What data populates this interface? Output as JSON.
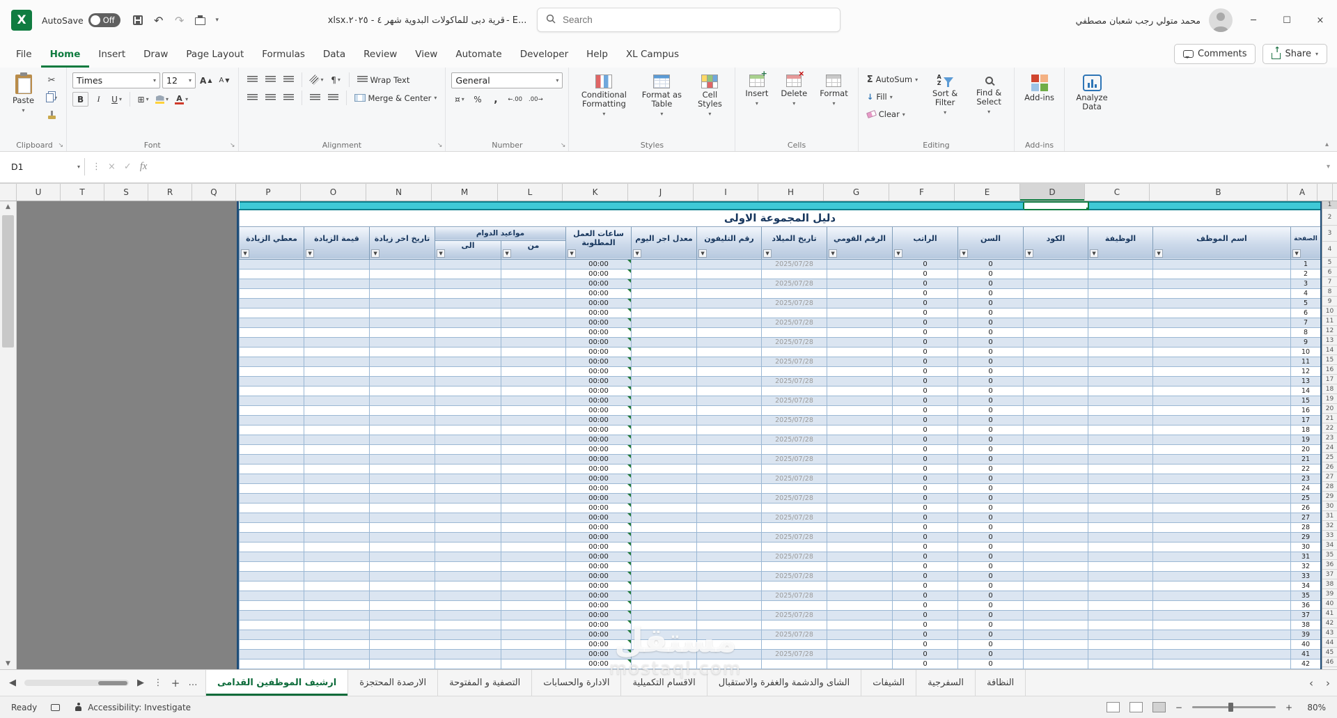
{
  "titlebar": {
    "autosave_label": "AutoSave",
    "autosave_state": "Off",
    "filename_arabic": "قرية دبى للماكولات البدوية شهر ٤ - ٢٠٢٥.xlsx",
    "filename_suffix": " - E...",
    "search_placeholder": "Search",
    "user_name": "محمد متولي رجب شعبان مصطفي"
  },
  "window_controls": {
    "minimize": "─",
    "maximize": "☐",
    "close": "×"
  },
  "ribbon": {
    "tabs": [
      "File",
      "Home",
      "Insert",
      "Draw",
      "Page Layout",
      "Formulas",
      "Data",
      "Review",
      "View",
      "Automate",
      "Developer",
      "Help",
      "XL Campus"
    ],
    "active_tab": "Home",
    "comments_label": "Comments",
    "share_label": "Share",
    "clipboard": {
      "paste": "Paste",
      "cut_glyph": "✂",
      "label": "Clipboard"
    },
    "font": {
      "name": "Times",
      "size": "12",
      "bold": "B",
      "italic": "I",
      "underline": "U",
      "grow": "A",
      "shrink": "A",
      "color_letter": "A",
      "label": "Font"
    },
    "alignment": {
      "wrap": "Wrap Text",
      "merge": "Merge & Center",
      "label": "Alignment"
    },
    "number": {
      "format": "General",
      "accounting": "¤",
      "percent": "%",
      "comma": ",",
      "inc_decimal": "←.00",
      "dec_decimal": ".00→",
      "label": "Number"
    },
    "styles": {
      "conditional": "Conditional Formatting",
      "format_table": "Format as Table",
      "cell_styles": "Cell Styles",
      "label": "Styles"
    },
    "cells": {
      "insert": "Insert",
      "delete": "Delete",
      "format": "Format",
      "label": "Cells"
    },
    "editing": {
      "sum_glyph": "Σ",
      "autosum": "AutoSum",
      "fill": "Fill",
      "clear": "Clear",
      "sort": "Sort & Filter",
      "find": "Find & Select",
      "label": "Editing"
    },
    "addins": {
      "button": "Add-ins",
      "label": "Add-ins"
    },
    "analyze": {
      "button": "Analyze Data"
    }
  },
  "formula_bar": {
    "name_box": "D1",
    "cancel": "×",
    "enter": "✓",
    "fx": "fx"
  },
  "grid": {
    "columns": [
      "U",
      "T",
      "S",
      "R",
      "Q",
      "P",
      "O",
      "N",
      "M",
      "L",
      "K",
      "J",
      "I",
      "H",
      "G",
      "F",
      "E",
      "D",
      "C",
      "B",
      "A"
    ],
    "selected_column": "D",
    "selected_cell": "D1",
    "row_numbers": [
      1,
      2,
      3,
      4,
      5,
      6,
      7,
      8,
      9,
      10,
      11,
      12,
      13,
      14,
      15,
      16,
      17,
      18,
      19,
      20,
      21,
      22,
      23,
      24,
      25,
      26,
      27,
      28,
      29,
      30,
      31,
      32,
      33,
      34,
      35,
      36,
      37,
      38,
      39,
      40,
      41,
      42,
      43,
      44,
      45,
      46
    ]
  },
  "sheet": {
    "title": "دليل المجموعة الاولى",
    "columns": [
      {
        "key": "P",
        "label": "معطي الزيادة"
      },
      {
        "key": "O",
        "label": "قيمة الزيادة"
      },
      {
        "key": "N",
        "label": "تاريخ اخر زيادة"
      },
      {
        "key": "M",
        "label": "الى",
        "group": "مواعيد الدوام"
      },
      {
        "key": "L",
        "label": "من",
        "group": "مواعيد الدوام"
      },
      {
        "key": "K",
        "label": "ساعات العمل المطلوبة"
      },
      {
        "key": "J",
        "label": "معدل اجر اليوم"
      },
      {
        "key": "I",
        "label": "رقم التليفون"
      },
      {
        "key": "H",
        "label": "تاريخ الميلاد"
      },
      {
        "key": "G",
        "label": "الرقم القومي"
      },
      {
        "key": "F",
        "label": "الراتب"
      },
      {
        "key": "E",
        "label": "السن"
      },
      {
        "key": "D",
        "label": "الكود"
      },
      {
        "key": "C",
        "label": "الوظيفة"
      },
      {
        "key": "B",
        "label": "اسم الموظف"
      },
      {
        "key": "A",
        "label": "الصفحة"
      }
    ],
    "rows": [
      {
        "serial": "1",
        "hours": "00:00",
        "birth": "2025/07/28",
        "salary": "0",
        "age": "0"
      },
      {
        "serial": "2",
        "hours": "00:00",
        "birth": "",
        "salary": "0",
        "age": "0"
      },
      {
        "serial": "3",
        "hours": "00:00",
        "birth": "2025/07/28",
        "salary": "0",
        "age": "0"
      },
      {
        "serial": "4",
        "hours": "00:00",
        "birth": "",
        "salary": "0",
        "age": "0"
      },
      {
        "serial": "5",
        "hours": "00:00",
        "birth": "2025/07/28",
        "salary": "0",
        "age": "0"
      },
      {
        "serial": "6",
        "hours": "00:00",
        "birth": "",
        "salary": "0",
        "age": "0"
      },
      {
        "serial": "7",
        "hours": "00:00",
        "birth": "2025/07/28",
        "salary": "0",
        "age": "0"
      },
      {
        "serial": "8",
        "hours": "00:00",
        "birth": "",
        "salary": "0",
        "age": "0"
      },
      {
        "serial": "9",
        "hours": "00:00",
        "birth": "2025/07/28",
        "salary": "0",
        "age": "0"
      },
      {
        "serial": "10",
        "hours": "00:00",
        "birth": "",
        "salary": "0",
        "age": "0"
      },
      {
        "serial": "11",
        "hours": "00:00",
        "birth": "2025/07/28",
        "salary": "0",
        "age": "0"
      },
      {
        "serial": "12",
        "hours": "00:00",
        "birth": "",
        "salary": "0",
        "age": "0"
      },
      {
        "serial": "13",
        "hours": "00:00",
        "birth": "2025/07/28",
        "salary": "0",
        "age": "0"
      },
      {
        "serial": "14",
        "hours": "00:00",
        "birth": "",
        "salary": "0",
        "age": "0"
      },
      {
        "serial": "15",
        "hours": "00:00",
        "birth": "2025/07/28",
        "salary": "0",
        "age": "0"
      },
      {
        "serial": "16",
        "hours": "00:00",
        "birth": "",
        "salary": "0",
        "age": "0"
      },
      {
        "serial": "17",
        "hours": "00:00",
        "birth": "2025/07/28",
        "salary": "0",
        "age": "0"
      },
      {
        "serial": "18",
        "hours": "00:00",
        "birth": "",
        "salary": "0",
        "age": "0"
      },
      {
        "serial": "19",
        "hours": "00:00",
        "birth": "2025/07/28",
        "salary": "0",
        "age": "0"
      },
      {
        "serial": "20",
        "hours": "00:00",
        "birth": "",
        "salary": "0",
        "age": "0"
      },
      {
        "serial": "21",
        "hours": "00:00",
        "birth": "2025/07/28",
        "salary": "0",
        "age": "0"
      },
      {
        "serial": "22",
        "hours": "00:00",
        "birth": "",
        "salary": "0",
        "age": "0"
      },
      {
        "serial": "23",
        "hours": "00:00",
        "birth": "2025/07/28",
        "salary": "0",
        "age": "0"
      },
      {
        "serial": "24",
        "hours": "00:00",
        "birth": "",
        "salary": "0",
        "age": "0"
      },
      {
        "serial": "25",
        "hours": "00:00",
        "birth": "2025/07/28",
        "salary": "0",
        "age": "0"
      },
      {
        "serial": "26",
        "hours": "00:00",
        "birth": "",
        "salary": "0",
        "age": "0"
      },
      {
        "serial": "27",
        "hours": "00:00",
        "birth": "2025/07/28",
        "salary": "0",
        "age": "0"
      },
      {
        "serial": "28",
        "hours": "00:00",
        "birth": "",
        "salary": "0",
        "age": "0"
      },
      {
        "serial": "29",
        "hours": "00:00",
        "birth": "2025/07/28",
        "salary": "0",
        "age": "0"
      },
      {
        "serial": "30",
        "hours": "00:00",
        "birth": "",
        "salary": "0",
        "age": "0"
      },
      {
        "serial": "31",
        "hours": "00:00",
        "birth": "2025/07/28",
        "salary": "0",
        "age": "0"
      },
      {
        "serial": "32",
        "hours": "00:00",
        "birth": "",
        "salary": "0",
        "age": "0"
      },
      {
        "serial": "33",
        "hours": "00:00",
        "birth": "2025/07/28",
        "salary": "0",
        "age": "0"
      },
      {
        "serial": "34",
        "hours": "00:00",
        "birth": "",
        "salary": "0",
        "age": "0"
      },
      {
        "serial": "35",
        "hours": "00:00",
        "birth": "2025/07/28",
        "salary": "0",
        "age": "0"
      },
      {
        "serial": "36",
        "hours": "00:00",
        "birth": "",
        "salary": "0",
        "age": "0"
      },
      {
        "serial": "37",
        "hours": "00:00",
        "birth": "2025/07/28",
        "salary": "0",
        "age": "0"
      },
      {
        "serial": "38",
        "hours": "00:00",
        "birth": "",
        "salary": "0",
        "age": "0"
      },
      {
        "serial": "39",
        "hours": "00:00",
        "birth": "2025/07/28",
        "salary": "0",
        "age": "0"
      },
      {
        "serial": "40",
        "hours": "00:00",
        "birth": "",
        "salary": "0",
        "age": "0"
      },
      {
        "serial": "41",
        "hours": "00:00",
        "birth": "2025/07/28",
        "salary": "0",
        "age": "0"
      },
      {
        "serial": "42",
        "hours": "00:00",
        "birth": "",
        "salary": "0",
        "age": "0"
      }
    ]
  },
  "sheet_tabs": {
    "active": "ارشيف الموظفين القدامى",
    "tabs": [
      "ارشيف الموظفين القدامى",
      "الارصدة المحتجزة",
      "التصفية و المفتوحة",
      "الادارة والحسابات",
      "الاقسام التكميلية",
      "الشاى والدشمة والغفرة والاستقبال",
      "الشيفات",
      "السفرجية",
      "النظافة"
    ]
  },
  "status_bar": {
    "ready": "Ready",
    "accessibility": "Accessibility: Investigate",
    "zoom_minus": "−",
    "zoom_plus": "+",
    "zoom": "80%"
  },
  "watermark": {
    "line1": "مستقل",
    "line2": "mostaql.com"
  },
  "colors": {
    "excel_green": "#107c41",
    "cyan_fill": "#3fc9d6",
    "stripe_blue": "#dbe5f1",
    "header_blue": "#ccd9ea",
    "pagebreak_gray": "#828282"
  }
}
